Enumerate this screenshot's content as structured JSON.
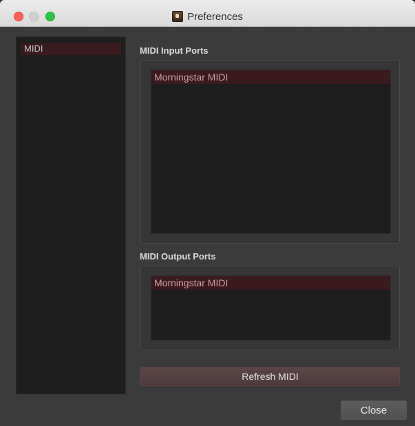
{
  "window": {
    "title": "Preferences",
    "app_icon": "app-icon"
  },
  "sidebar": {
    "items": [
      {
        "label": "MIDI",
        "selected": true
      }
    ]
  },
  "input_ports": {
    "label": "MIDI Input Ports",
    "items": [
      {
        "label": "Morningstar MIDI",
        "selected": true
      }
    ]
  },
  "output_ports": {
    "label": "MIDI Output Ports",
    "items": [
      {
        "label": "Morningstar MIDI",
        "selected": true
      }
    ]
  },
  "buttons": {
    "refresh_label": "Refresh MIDI",
    "close_label": "Close"
  },
  "colors": {
    "selection": "#3a1a1e",
    "background": "#3b3b3b",
    "list_background": "#1e1e1e"
  }
}
